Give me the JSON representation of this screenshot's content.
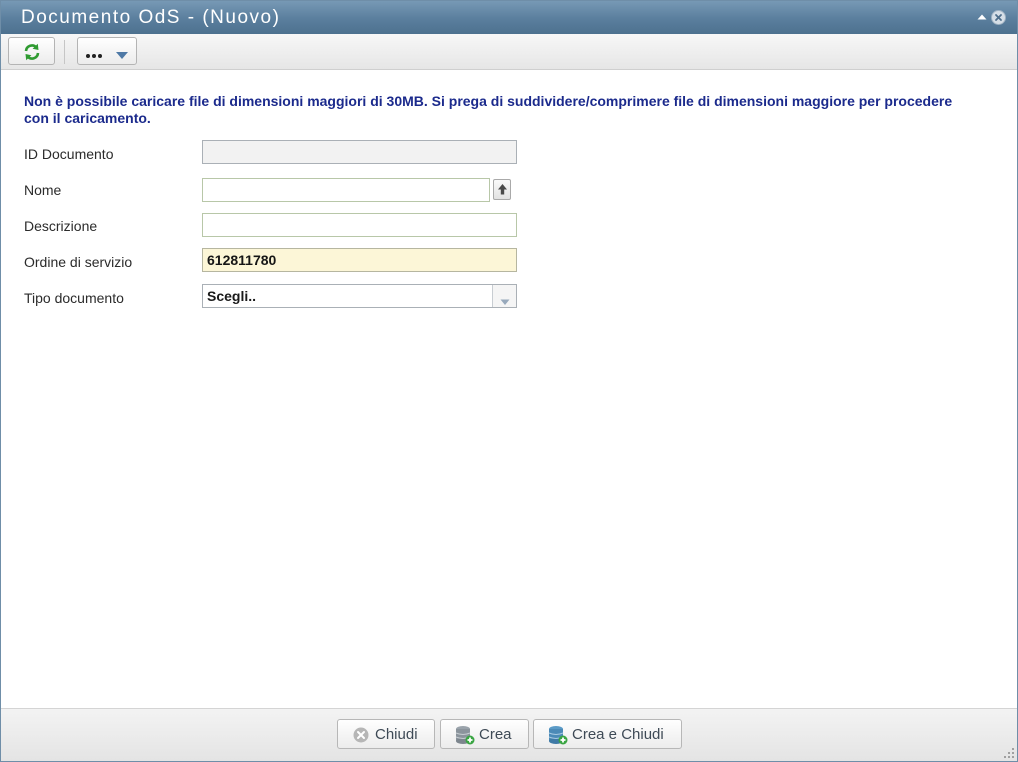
{
  "window": {
    "title": "Documento OdS - (Nuovo)",
    "collapse_icon": "caret-up-icon",
    "close_icon": "close-circle-icon"
  },
  "toolbar": {
    "refresh_icon": "refresh-arrows-icon",
    "more_icon": "ellipsis-icon",
    "dropdown_icon": "chevron-down-icon"
  },
  "notice": {
    "text": "Non è possibile caricare file di dimensioni maggiori di 30MB. Si prega di suddividere/comprimere file di dimensioni maggiore per procedere con il caricamento."
  },
  "form": {
    "id_documento": {
      "label": "ID Documento",
      "value": ""
    },
    "nome": {
      "label": "Nome",
      "value": "",
      "upload_icon": "upload-arrow-icon"
    },
    "descrizione": {
      "label": "Descrizione",
      "value": ""
    },
    "ordine_servizio": {
      "label": "Ordine di servizio",
      "value": "612811780"
    },
    "tipo_documento": {
      "label": "Tipo documento",
      "selected": "Scegli.."
    }
  },
  "footer": {
    "chiudi_label": "Chiudi",
    "crea_label": "Crea",
    "crea_chiudi_label": "Crea e Chiudi"
  },
  "colors": {
    "title_bar": "#5a7e9d",
    "notice_text": "#1b2a8c",
    "highlight_field": "#fcf6d7"
  }
}
